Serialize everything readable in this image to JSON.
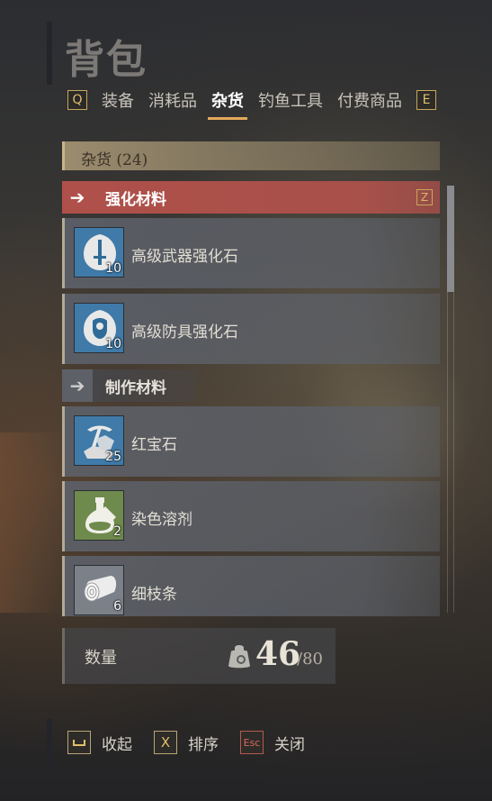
{
  "window": {
    "title": "背包"
  },
  "tabs": {
    "prev_key": "Q",
    "next_key": "E",
    "items": [
      {
        "label": "装备",
        "active": false
      },
      {
        "label": "消耗品",
        "active": false
      },
      {
        "label": "杂货",
        "active": true
      },
      {
        "label": "钓鱼工具",
        "active": false
      },
      {
        "label": "付费商品",
        "active": false
      }
    ]
  },
  "panel": {
    "header": "杂货 (24)"
  },
  "categories": [
    {
      "label": "强化材料",
      "key": "Z",
      "selected": true,
      "icon": "arrow-right-icon"
    },
    {
      "label": "制作材料",
      "selected": false,
      "icon": "arrow-right-icon"
    }
  ],
  "items": [
    {
      "name": "高级武器强化石",
      "count": "10",
      "icon": "sword-stone-icon",
      "color": "#3f7aa8"
    },
    {
      "name": "高级防具强化石",
      "count": "10",
      "icon": "armor-stone-icon",
      "color": "#3f7aa8"
    },
    {
      "name": "红宝石",
      "count": "25",
      "icon": "pickaxe-ore-icon",
      "color": "#3f7aa8"
    },
    {
      "name": "染色溶剂",
      "count": "2",
      "icon": "potion-flask-icon",
      "color": "#6e8a4c"
    },
    {
      "name": "细枝条",
      "count": "6",
      "icon": "wood-log-icon",
      "color": "#7c8088"
    }
  ],
  "capacity": {
    "label": "数量",
    "current": "46",
    "max": "/80",
    "icon": "bag-icon"
  },
  "bottom_actions": [
    {
      "key": "⎵",
      "label": "收起",
      "icon": "space-key-icon"
    },
    {
      "key": "X",
      "label": "排序"
    },
    {
      "key": "Esc",
      "label": "关闭"
    }
  ],
  "colors": {
    "accent": "#e4a95c",
    "selected_category": "#b0504a",
    "key_border": "#c8a65a"
  }
}
